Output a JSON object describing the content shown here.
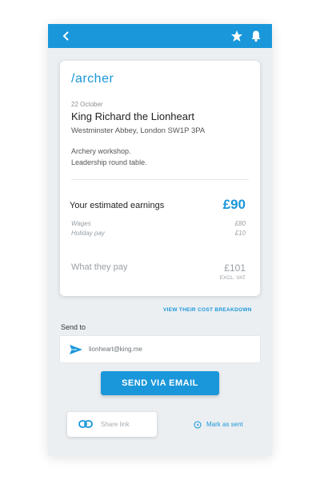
{
  "colors": {
    "accent": "#1a97da",
    "background": "#eceff2"
  },
  "topbar": {
    "back_icon": "chevron-left-icon",
    "star_icon": "star-icon",
    "bell_icon": "bell-icon"
  },
  "card": {
    "logo": "/archer",
    "date": "22 October",
    "title": "King Richard the Lionheart",
    "address": "Westminster Abbey, London SW1P 3PA",
    "description_lines": [
      "Archery workshop.",
      "Leadership round table."
    ],
    "earnings_label": "Your estimated earnings",
    "earnings_value": "£90",
    "breakdown_rows": [
      {
        "label": "Wages",
        "value": "£80"
      },
      {
        "label": "Holiday pay",
        "value": "£10"
      }
    ],
    "they_pay_label": "What they pay",
    "they_pay_value": "£101",
    "they_pay_note": "EXCL. VAT"
  },
  "cost_breakdown_link": "VIEW THEIR COST BREAKDOWN",
  "send_to": {
    "label": "Send to",
    "email": "lionheart@king.me",
    "icon": "send-icon"
  },
  "send_button": "SEND VIA EMAIL",
  "share_link": {
    "label": "Share link",
    "icon": "link-icon"
  },
  "mark_as_sent": {
    "label": "Mark as sent",
    "icon": "check-circle-icon"
  }
}
